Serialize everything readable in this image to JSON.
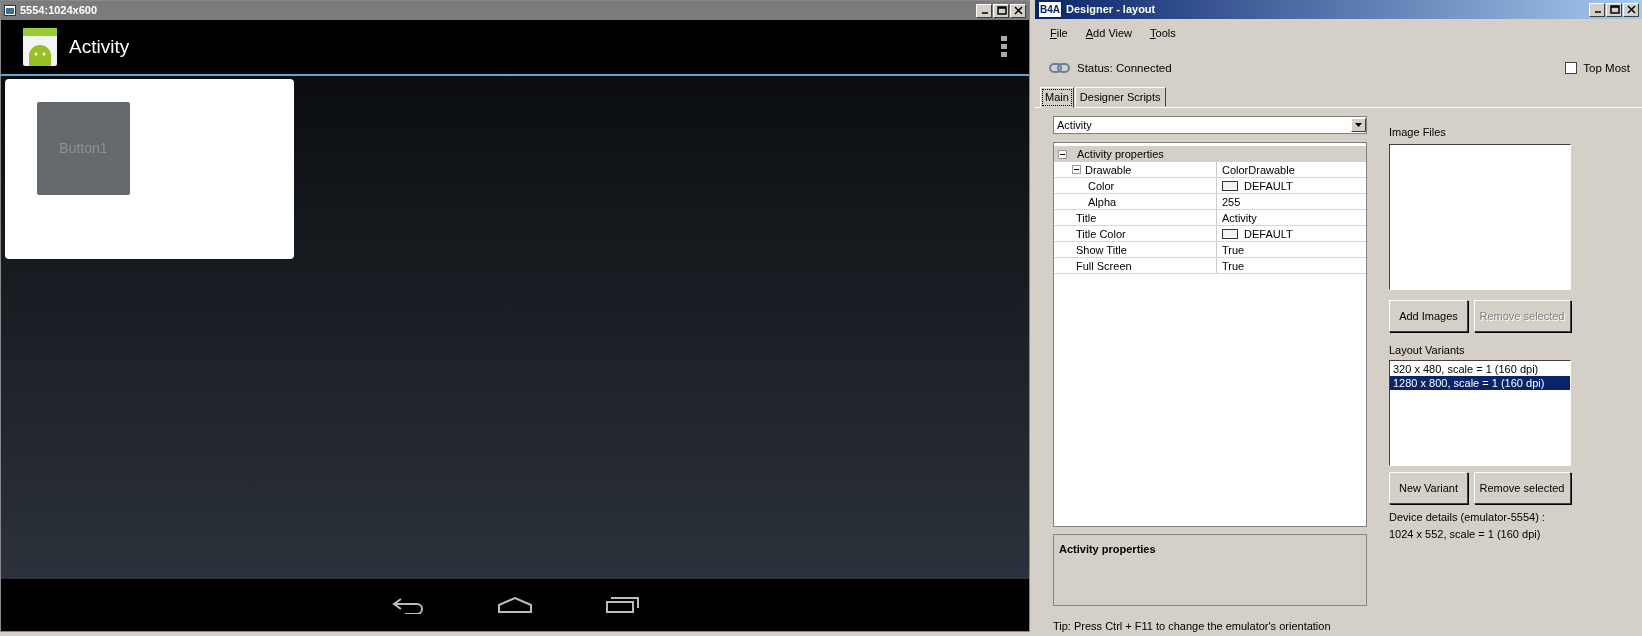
{
  "emulator": {
    "title": "5554:1024x600",
    "action_bar": {
      "title": "Activity"
    },
    "button": {
      "label": "Button1"
    }
  },
  "designer": {
    "logo": "B4A",
    "title": "Designer - layout",
    "menu": [
      {
        "label": "File"
      },
      {
        "label": "Add View"
      },
      {
        "label": "Tools"
      }
    ],
    "status": "Status: Connected",
    "top_most": {
      "label": "Top Most",
      "checked": false
    },
    "tabs": [
      {
        "label": "Main",
        "selected": true
      },
      {
        "label": "Designer Scripts",
        "selected": false
      }
    ],
    "object_select": {
      "value": "Activity"
    },
    "properties": [
      {
        "name": "Activity properties",
        "kind": "category",
        "expanded": true,
        "children": [
          {
            "name": "Drawable",
            "value": "ColorDrawable",
            "kind": "text",
            "expanded": true,
            "children": [
              {
                "name": "Color",
                "value": "DEFAULT",
                "kind": "color"
              },
              {
                "name": "Alpha",
                "value": "255",
                "kind": "text"
              }
            ]
          },
          {
            "name": "Title",
            "value": "Activity",
            "kind": "text"
          },
          {
            "name": "Title Color",
            "value": "DEFAULT",
            "kind": "color"
          },
          {
            "name": "Show Title",
            "value": "True",
            "kind": "text"
          },
          {
            "name": "Full Screen",
            "value": "True",
            "kind": "text"
          }
        ]
      }
    ],
    "description": {
      "title": "Activity properties"
    },
    "tip": "Tip: Press Ctrl + F11 to change the emulator's orientation",
    "image_files": {
      "label": "Image Files",
      "buttons": [
        {
          "label": "Add Images",
          "disabled": false
        },
        {
          "label": "Remove selected",
          "disabled": true
        }
      ]
    },
    "layout_variants": {
      "label": "Layout Variants",
      "items": [
        {
          "label": "320 x 480, scale = 1 (160 dpi)",
          "selected": false
        },
        {
          "label": "1280 x 800, scale = 1 (160 dpi)",
          "selected": true
        }
      ],
      "buttons": [
        {
          "label": "New Variant",
          "disabled": false
        },
        {
          "label": "Remove selected",
          "disabled": false
        }
      ]
    },
    "device_details": [
      "Device details (emulator-5554) :",
      "1024 x 552, scale = 1 (160 dpi)"
    ]
  }
}
